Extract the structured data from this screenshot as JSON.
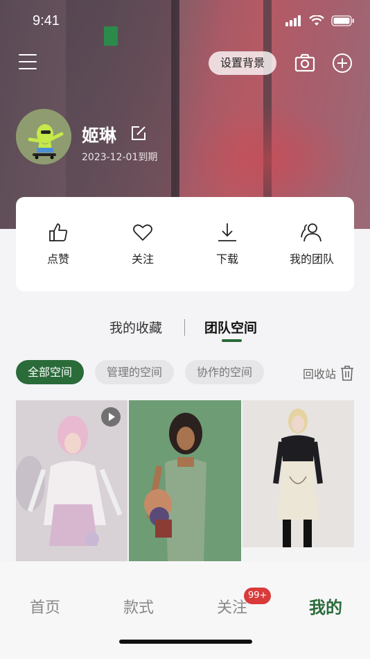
{
  "status_bar": {
    "time": "9:41"
  },
  "topbar": {
    "set_background_label": "设置背景"
  },
  "profile": {
    "name": "姬琳",
    "expire": "2023-12-01到期"
  },
  "actions": [
    {
      "label": "点赞",
      "icon": "thumbs-up-icon"
    },
    {
      "label": "关注",
      "icon": "heart-icon"
    },
    {
      "label": "下载",
      "icon": "download-icon"
    },
    {
      "label": "我的团队",
      "icon": "team-icon"
    }
  ],
  "tabs": {
    "collect": "我的收藏",
    "team_space": "团队空间",
    "active": "团队空间"
  },
  "chips": [
    {
      "label": "全部空间",
      "active": true
    },
    {
      "label": "管理的空间",
      "active": false
    },
    {
      "label": "协作的空间",
      "active": false
    }
  ],
  "recycle_label": "回收站",
  "bottom_nav": {
    "home": "首页",
    "style": "款式",
    "follow": "关注",
    "follow_badge": "99+",
    "mine": "我的",
    "active": "我的"
  },
  "colors": {
    "accent": "#2a6b3a",
    "badge": "#d93a3a"
  }
}
